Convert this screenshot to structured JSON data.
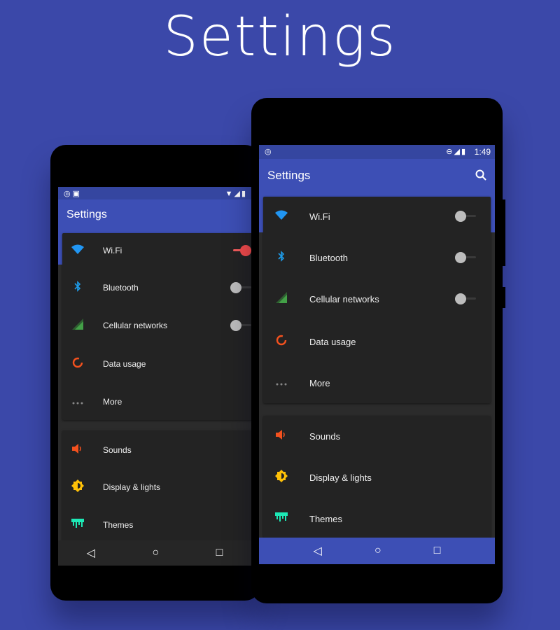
{
  "headline": "Settings",
  "colors": {
    "background": "#3b48a9",
    "toolbar": "#3d4fb5",
    "card": "#232323",
    "wifi": "#2196f3",
    "bluetooth": "#1e9be8",
    "cellular": "#43a047",
    "data": "#f4511e",
    "sound": "#f4511e",
    "display": "#ffc107",
    "themes": "#1de9b6",
    "switch_on": "#f44b4b"
  },
  "left_phone": {
    "status_icons_left": "◎ ▣",
    "status_icons_right": "▼◢▮",
    "title": "Settings",
    "items": [
      {
        "label": "Wi.Fi",
        "icon": "wifi-icon",
        "switch": "on"
      },
      {
        "label": "Bluetooth",
        "icon": "bluetooth-icon",
        "switch": "off"
      },
      {
        "label": "Cellular networks",
        "icon": "signal-icon",
        "switch": "off"
      },
      {
        "label": "Data usage",
        "icon": "data-usage-icon"
      },
      {
        "label": "More",
        "icon": "more-icon"
      },
      {
        "label": "Sounds",
        "icon": "volume-icon"
      },
      {
        "label": "Display & lights",
        "icon": "brightness-icon"
      },
      {
        "label": "Themes",
        "icon": "themes-icon"
      }
    ]
  },
  "right_phone": {
    "status_icons_left": "◎",
    "status_icons_right": "⊖◢▮",
    "time": "1:49",
    "title": "Settings",
    "search_icon": "search-icon",
    "items": [
      {
        "label": "Wi.Fi",
        "icon": "wifi-icon",
        "switch": "off"
      },
      {
        "label": "Bluetooth",
        "icon": "bluetooth-icon",
        "switch": "off"
      },
      {
        "label": "Cellular networks",
        "icon": "signal-icon",
        "switch": "off"
      },
      {
        "label": "Data usage",
        "icon": "data-usage-icon"
      },
      {
        "label": "More",
        "icon": "more-icon"
      },
      {
        "label": "Sounds",
        "icon": "volume-icon"
      },
      {
        "label": "Display & lights",
        "icon": "brightness-icon"
      },
      {
        "label": "Themes",
        "icon": "themes-icon"
      }
    ]
  },
  "nav": {
    "back": "◁",
    "home": "○",
    "recents": "□"
  }
}
